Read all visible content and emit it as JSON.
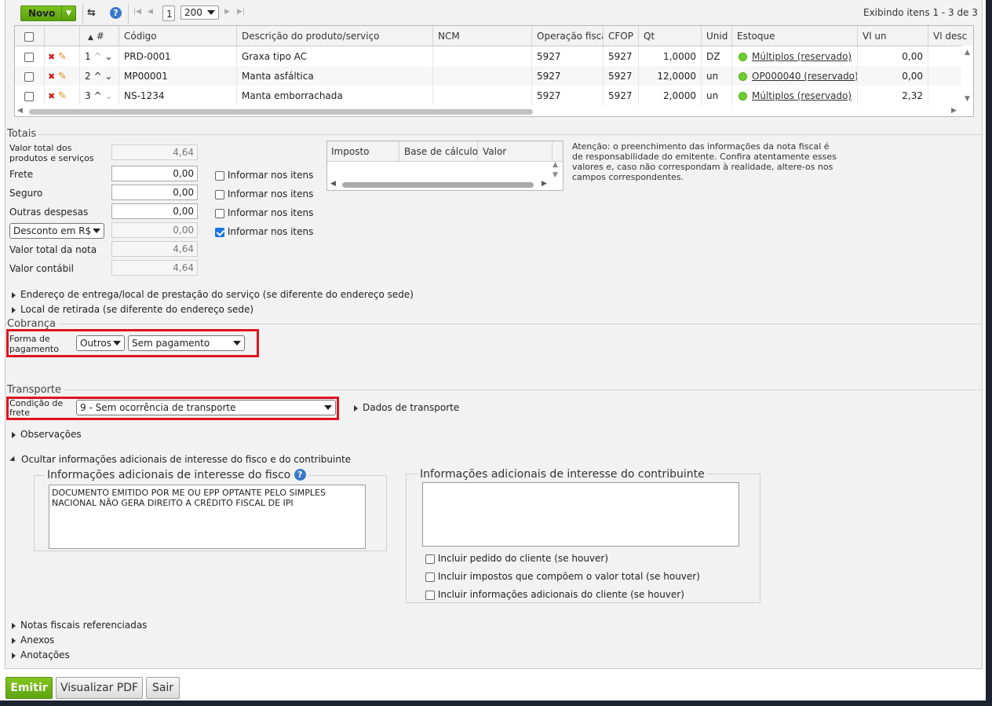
{
  "toolbar": {
    "new_label": "Novo",
    "page": "1",
    "page_size": "200",
    "items_info": "Exibindo itens 1 - 3 de 3"
  },
  "grid": {
    "columns": [
      "#",
      "Código",
      "Descrição do produto/serviço",
      "NCM",
      "Operação fiscal",
      "CFOP",
      "Qt",
      "Unid",
      "Estoque",
      "Vl un",
      "Vl desc"
    ],
    "rows": [
      {
        "n": "1",
        "codigo": "PRD-0001",
        "descricao": "Graxa tipo AC",
        "ncm": "",
        "operacao": "5927",
        "cfop": "5927",
        "qt": "1,0000",
        "unid": "DZ",
        "estoque": "Múltiplos (reservado)",
        "vlun": "0,00"
      },
      {
        "n": "2",
        "codigo": "MP00001",
        "descricao": "Manta asfáltica",
        "ncm": "",
        "operacao": "5927",
        "cfop": "5927",
        "qt": "12,0000",
        "unid": "un",
        "estoque": "OP000040 (reservado)",
        "vlun": "0,00"
      },
      {
        "n": "3",
        "codigo": "NS-1234",
        "descricao": "Manta emborrachada",
        "ncm": "",
        "operacao": "5927",
        "cfop": "5927",
        "qt": "2,0000",
        "unid": "un",
        "estoque": "Múltiplos (reservado)",
        "vlun": "2,32"
      }
    ]
  },
  "totais": {
    "title": "Totais",
    "valor_total_label": "Valor total dos produtos e serviços",
    "valor_total": "4,64",
    "frete_label": "Frete",
    "frete": "0,00",
    "seguro_label": "Seguro",
    "seguro": "0,00",
    "outras_label": "Outras despesas",
    "outras": "0,00",
    "desconto_select": "Desconto em R$",
    "desconto": "0,00",
    "total_nota_label": "Valor total da nota",
    "total_nota": "4,64",
    "contabil_label": "Valor contábil",
    "contabil": "4,64",
    "informar_label": "Informar nos itens",
    "imposto_cols": [
      "Imposto",
      "Base de cálculo",
      "Valor"
    ],
    "warning": "Atenção: o preenchimento das informações da nota fiscal é de responsabilidade do emitente. Confira atentamente esses valores e, caso não correspondam à realidade, altere-os nos campos correspondentes."
  },
  "links": {
    "endereco_entrega": "Endereço de entrega/local de prestação do serviço (se diferente do endereço sede)",
    "local_retirada": "Local de retirada (se diferente do endereço sede)",
    "observacoes": "Observações",
    "ocultar_info": "Ocultar informações adicionais de interesse do fisco e do contribuinte",
    "dados_transporte": "Dados de transporte",
    "notas_ref": "Notas fiscais referenciadas",
    "anexos": "Anexos",
    "anotacoes": "Anotações"
  },
  "cobranca": {
    "title": "Cobrança",
    "forma_label": "Forma de pagamento",
    "forma_value": "Outros",
    "pagamento_value": "Sem pagamento"
  },
  "transporte": {
    "title": "Transporte",
    "condicao_label": "Condição de frete",
    "condicao_value": "9 - Sem ocorrência de transporte"
  },
  "info_fisco": {
    "legend": "Informações adicionais de interesse do fisco",
    "text": "DOCUMENTO EMITIDO POR ME OU EPP OPTANTE PELO SIMPLES NACIONAL NÃO GERA DIREITO A CRÉDITO FISCAL DE IPI"
  },
  "info_contribuinte": {
    "legend": "Informações adicionais de interesse do contribuinte",
    "text": "",
    "opt1": "Incluir pedido do cliente (se houver)",
    "opt2": "Incluir impostos que compõem o valor total (se houver)",
    "opt3": "Incluir informações adicionais do cliente (se houver)"
  },
  "actions": {
    "emitir": "Emitir",
    "visualizar": "Visualizar PDF",
    "sair": "Sair"
  }
}
